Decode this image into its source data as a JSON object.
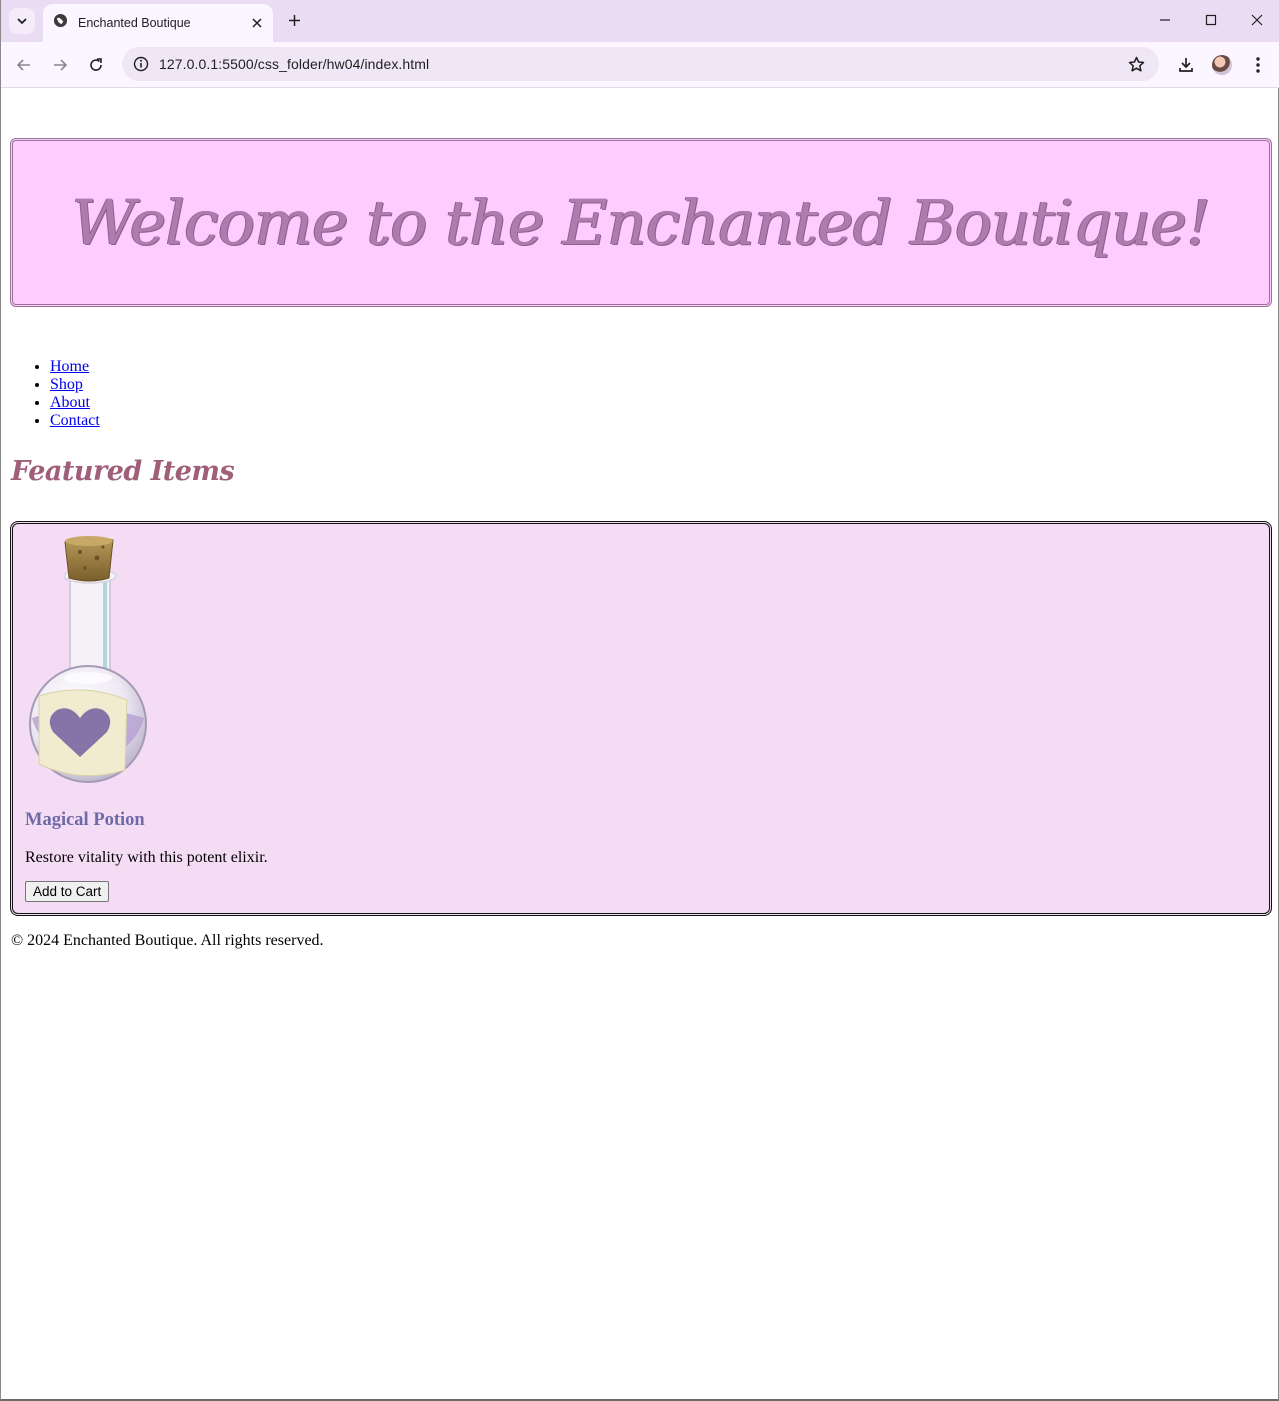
{
  "browser": {
    "tab_title": "Enchanted Boutique",
    "url": "127.0.0.1:5500/css_folder/hw04/index.html"
  },
  "page": {
    "header_title": "Welcome to the Enchanted Boutique!",
    "nav": [
      "Home",
      "Shop",
      "About",
      "Contact"
    ],
    "section_title": "Featured Items",
    "product": {
      "name": "Magical Potion",
      "description": "Restore vitality with this potent elixir.",
      "button_label": "Add to Cart"
    },
    "footer": "© 2024 Enchanted Boutique. All rights reserved."
  },
  "colors": {
    "header_bg": "#ffccff",
    "title_color": "#b07cae",
    "section_title_color": "#a05f78",
    "card_bg": "#f5dcf5",
    "product_name_color": "#6e6aa8"
  },
  "icons": [
    "tab-search-icon",
    "globe-icon",
    "close-icon",
    "plus-icon",
    "minimize-icon",
    "maximize-icon",
    "back-icon",
    "forward-icon",
    "reload-icon",
    "info-icon",
    "star-icon",
    "download-icon",
    "menu-icon"
  ]
}
